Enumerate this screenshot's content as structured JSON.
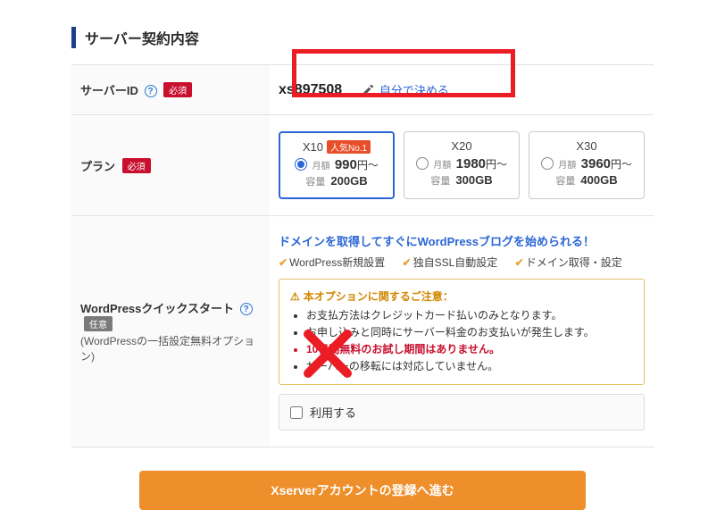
{
  "section_title": "サーバー契約内容",
  "required_badge": "必須",
  "optional_badge": "任意",
  "server_id": {
    "label": "サーバーID",
    "value": "xs897508",
    "decide_link": "自分で決める"
  },
  "plan": {
    "label": "プラン",
    "popular_badge": "人気No.1",
    "monthly_label": "月額",
    "capacity_label": "容量",
    "yen_suffix": "円～",
    "options": [
      {
        "name": "X10",
        "price": "990",
        "capacity": "200GB",
        "popular": true,
        "selected": true
      },
      {
        "name": "X20",
        "price": "1980",
        "capacity": "300GB",
        "popular": false,
        "selected": false
      },
      {
        "name": "X30",
        "price": "3960",
        "capacity": "400GB",
        "popular": false,
        "selected": false
      }
    ]
  },
  "quickstart": {
    "label_line1": "WordPressクイックスタート",
    "label_line2": "(WordPressの一括設定無料オプション)",
    "headline": "ドメインを取得してすぐにWordPressブログを始められる！",
    "features": [
      "WordPress新規設置",
      "独自SSL自動設定",
      "ドメイン取得・設定"
    ],
    "notice_title": "本オプションに関するご注意：",
    "notice_items": [
      {
        "text": "お支払方法はクレジットカード払いのみとなります。",
        "red": false
      },
      {
        "text": "お申し込みと同時にサーバー料金のお支払いが発生します。",
        "red": false
      },
      {
        "text": "10日間無料のお試し期間はありません。",
        "red": true
      },
      {
        "text": "サーバーの移転には対応していません。",
        "red": false
      }
    ],
    "checkbox_label": "利用する"
  },
  "submit_label": "Xserverアカウントの登録へ進む",
  "colors": {
    "accent_blue": "#2a66d6",
    "brand_red": "#c8102e",
    "orange": "#ee8f2b",
    "annotation_red": "#ec1c24"
  }
}
